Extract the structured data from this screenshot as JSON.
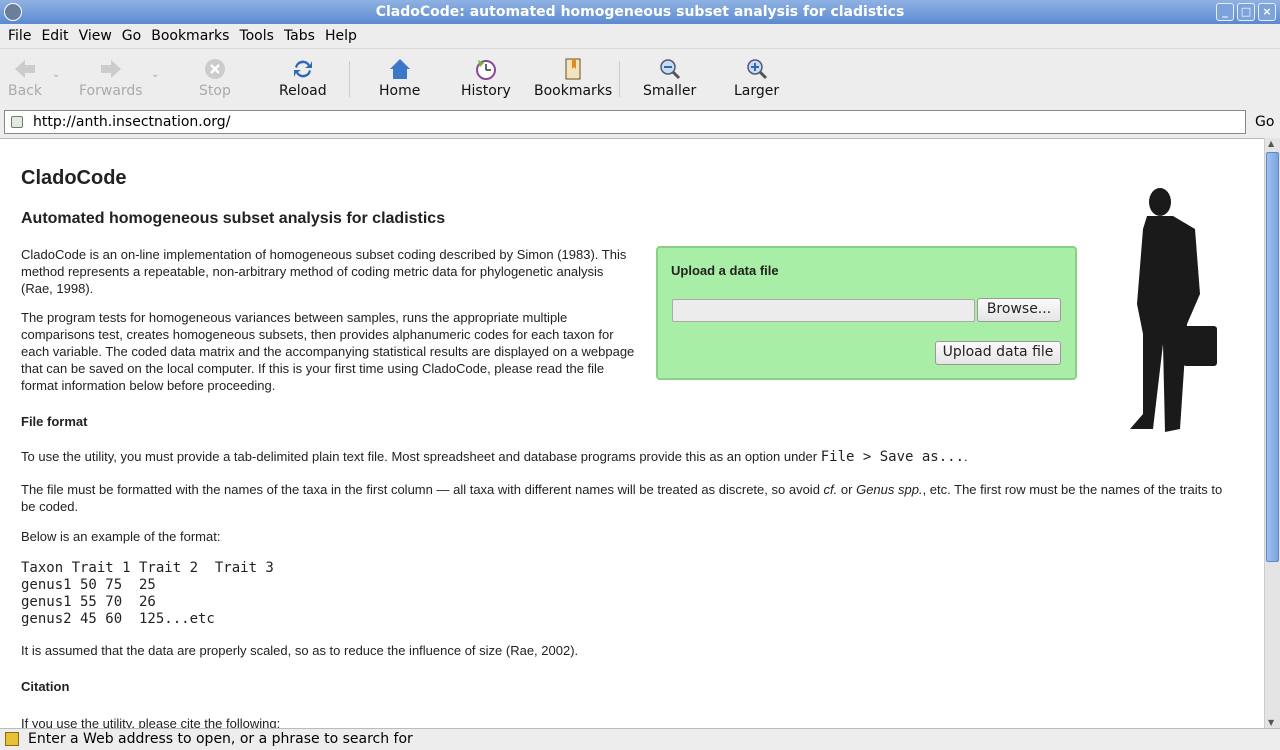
{
  "window": {
    "title": "CladoCode: automated homogeneous subset analysis for cladistics"
  },
  "menu": [
    "File",
    "Edit",
    "View",
    "Go",
    "Bookmarks",
    "Tools",
    "Tabs",
    "Help"
  ],
  "toolbar": {
    "back": "Back",
    "forwards": "Forwards",
    "stop": "Stop",
    "reload": "Reload",
    "home": "Home",
    "history": "History",
    "bookmarks": "Bookmarks",
    "smaller": "Smaller",
    "larger": "Larger"
  },
  "url": {
    "value": "http://anth.insectnation.org/",
    "go": "Go"
  },
  "page": {
    "title": "CladoCode",
    "subtitle": "Automated homogeneous subset analysis for cladistics",
    "intro1": "CladoCode is an on-line implementation of homogeneous subset coding described by Simon (1983). This method represents a repeatable, non-arbitrary method of coding metric data for phylogenetic analysis (Rae, 1998).",
    "intro2": "The program tests for homogeneous variances between samples, runs the appropriate multiple comparisons test, creates homogeneous subsets, then provides alphanumeric codes for each taxon for each variable. The coded data matrix and the accompanying statistical results are displayed on a webpage that can be saved on the local computer. If this is your first time using CladoCode, please read the file format information below before proceeding.",
    "file_format_heading": "File format",
    "ff1": "To use the utility, you must provide a tab-delimited plain text file. Most spreadsheet and database programs provide this as an option under ",
    "ff1_code": "File > Save as...",
    "ff1_end": ".",
    "ff2_a": "The file must be formatted with the names of the taxa in the first column — all taxa with different names will be treated as discrete, so avoid ",
    "ff2_cf": "cf.",
    "ff2_b": " or ",
    "ff2_genus": "Genus spp.",
    "ff2_c": ", etc. The first row must be the names of the traits to be coded.",
    "example_intro": "Below is an example of the format:",
    "example": [
      "Taxon Trait 1 Trait 2  Trait 3",
      "genus1 50 75  25",
      "genus1 55 70  26",
      "genus2 45 60  125...etc"
    ],
    "scaled": "It is assumed that the data are properly scaled, so as to reduce the influence of size (Rae, 2002).",
    "citation_heading": "Citation",
    "citation_intro": "If you use the utility, please cite the following:"
  },
  "upload": {
    "heading": "Upload a data file",
    "browse": "Browse...",
    "submit": "Upload data file",
    "bg": "#a9eea6"
  },
  "status": "Enter a Web address to open, or a phrase to search for"
}
